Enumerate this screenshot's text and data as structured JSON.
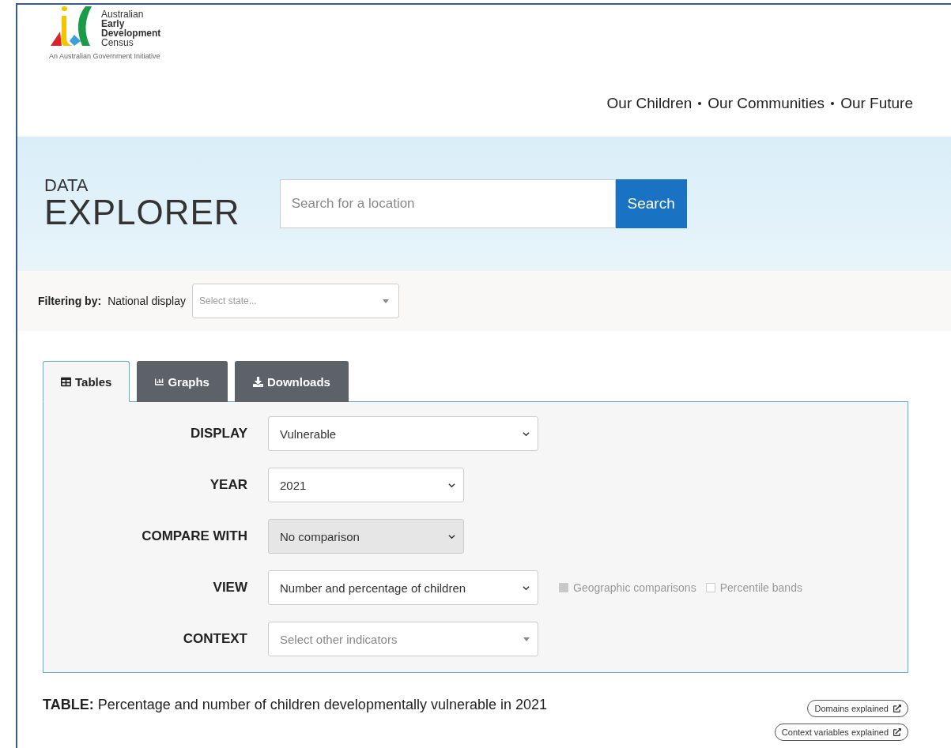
{
  "logo": {
    "lines": [
      "Australian",
      "Early",
      "Development",
      "Census"
    ],
    "tagline": "An Australian Government Initiative"
  },
  "tagline": [
    "Our Children",
    "Our Communities",
    "Our Future"
  ],
  "hero": {
    "title_small": "DATA",
    "title_large": "EXPLORER",
    "search": {
      "placeholder": "Search for a location",
      "button": "Search"
    }
  },
  "filter": {
    "label": "Filtering by:",
    "value": "National display",
    "select": {
      "placeholder": "Select state..."
    }
  },
  "tabs": [
    {
      "label": "Tables",
      "selected": true
    },
    {
      "label": "Graphs",
      "selected": false
    },
    {
      "label": "Downloads",
      "selected": false
    }
  ],
  "form": [
    {
      "label": "DISPLAY",
      "kind": "select",
      "value": "Vulnerable",
      "disabled": false
    },
    {
      "label": "YEAR",
      "kind": "select",
      "value": "2021",
      "disabled": false
    },
    {
      "label": "COMPARE WITH",
      "kind": "select",
      "value": "No comparison",
      "disabled": true
    },
    {
      "label": "VIEW",
      "kind": "select",
      "value": "Number and percentage of children",
      "disabled": false,
      "options": [
        {
          "label": "Geographic comparisons",
          "checked": true
        },
        {
          "label": "Percentile bands",
          "checked": false
        }
      ]
    },
    {
      "label": "CONTEXT",
      "kind": "multi",
      "placeholder": "Select other indicators",
      "disabled": false
    }
  ],
  "table_caption": {
    "label": "TABLE:",
    "text": "Percentage and number of children developmentally vulnerable in 2021"
  },
  "links": [
    "Domains explained",
    "Context variables explained"
  ]
}
